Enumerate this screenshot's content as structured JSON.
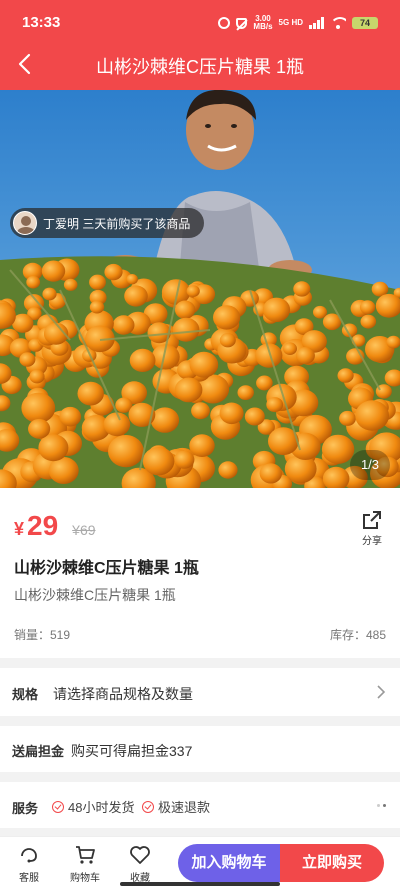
{
  "status_bar": {
    "time": "13:33",
    "net_speed_value": "3.00",
    "net_speed_unit": "MB/s",
    "network": "5G HD",
    "battery": "74"
  },
  "header": {
    "title": "山彬沙棘维C压片糖果 1瓶",
    "back_icon": "chevron-left-icon",
    "background": "#f2484a"
  },
  "gallery": {
    "recent_buyer": "丁爱明 三天前购买了该商品",
    "pager": "1/3"
  },
  "product": {
    "currency": "¥",
    "price": "29",
    "original_price": "¥69",
    "title": "山彬沙棘维C压片糖果 1瓶",
    "subtitle": "山彬沙棘维C压片糖果 1瓶",
    "sales": "销量：519",
    "stock": "库存：485",
    "share_label": "分享",
    "price_color": "#f2484a"
  },
  "spec": {
    "label": "规格",
    "prompt": "请选择商品规格及数量"
  },
  "bonus": {
    "label": "送扁担金",
    "text": "购买可得扁担金337"
  },
  "service": {
    "label": "服务",
    "items": [
      "48小时发货",
      "极速退款"
    ]
  },
  "bottom_bar": {
    "service": "客服",
    "cart": "购物车",
    "favorite": "收藏",
    "add_to_cart": "加入购物车",
    "buy_now": "立即购买",
    "add_to_cart_color": "#6e61e8",
    "buy_now_color": "#f2484a"
  }
}
